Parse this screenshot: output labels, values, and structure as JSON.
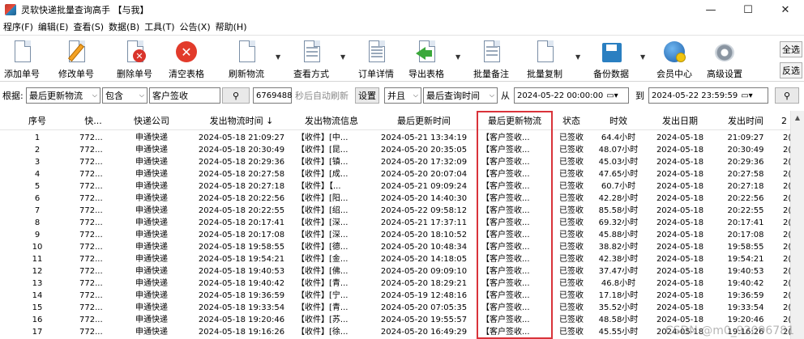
{
  "window": {
    "title": "灵软快递批量查询高手 【与我】",
    "minimize": "—",
    "maximize": "☐",
    "close": "✕"
  },
  "menu": [
    "程序(F)",
    "编辑(E)",
    "查看(S)",
    "数据(B)",
    "工具(T)",
    "公告(X)",
    "帮助(H)"
  ],
  "toolbar": {
    "add": "添加单号",
    "edit": "修改单号",
    "delete": "删除单号",
    "clear": "清空表格",
    "refresh": "刷新物流",
    "view": "查看方式",
    "detail": "订单详情",
    "export": "导出表格",
    "note": "批量备注",
    "copy": "批量复制",
    "backup": "备份数据",
    "member": "会员中心",
    "advanced": "高级设置",
    "select_all": "全选",
    "invert": "反选"
  },
  "filter": {
    "label": "根据:",
    "field": "最后更新物流",
    "op": "包含",
    "value": "客户签收",
    "counter": "6769488",
    "auto_refresh": "秒后自动刷新",
    "settings": "设置",
    "logic": "并且",
    "time_field": "最后查询时间",
    "from": "从",
    "from_value": "2024-05-22 00:00:00",
    "to": "到",
    "to_value": "2024-05-22 23:59:59"
  },
  "table": {
    "headers": [
      "序号",
      "快...",
      "快递公司",
      "发出物流时间 ↓",
      "发出物流信息",
      "最后更新时间",
      "最后更新物流",
      "状态",
      "时效",
      "发出日期",
      "发出时间",
      "2"
    ],
    "rows": [
      [
        "1",
        "772...",
        "申通快递",
        "2024-05-18 21:09:27",
        "【收件】[中...",
        "2024-05-21 13:34:19",
        "【客户签收...",
        "已签收",
        "64.4小时",
        "2024-05-18",
        "21:09:27",
        "2("
      ],
      [
        "2",
        "772...",
        "申通快递",
        "2024-05-18 20:30:49",
        "【收件】[昆...",
        "2024-05-20 20:35:05",
        "【客户签收...",
        "已签收",
        "48.07小时",
        "2024-05-18",
        "20:30:49",
        "2("
      ],
      [
        "3",
        "772...",
        "申通快递",
        "2024-05-18 20:29:36",
        "【收件】[镇...",
        "2024-05-20 17:32:09",
        "【客户签收...",
        "已签收",
        "45.03小时",
        "2024-05-18",
        "20:29:36",
        "2("
      ],
      [
        "4",
        "772...",
        "申通快递",
        "2024-05-18 20:27:58",
        "【收件】[成...",
        "2024-05-20 20:07:04",
        "【客户签收...",
        "已签收",
        "47.65小时",
        "2024-05-18",
        "20:27:58",
        "2("
      ],
      [
        "5",
        "772...",
        "申通快递",
        "2024-05-18 20:27:18",
        "【收件】【...",
        "2024-05-21 09:09:24",
        "【客户签收...",
        "已签收",
        "60.7小时",
        "2024-05-18",
        "20:27:18",
        "2("
      ],
      [
        "6",
        "772...",
        "申通快递",
        "2024-05-18 20:22:56",
        "【收件】[阳...",
        "2024-05-20 14:40:30",
        "【客户签收...",
        "已签收",
        "42.28小时",
        "2024-05-18",
        "20:22:56",
        "2("
      ],
      [
        "7",
        "772...",
        "申通快递",
        "2024-05-18 20:22:55",
        "【收件】[绍...",
        "2024-05-22 09:58:12",
        "【客户签收...",
        "已签收",
        "85.58小时",
        "2024-05-18",
        "20:22:55",
        "2("
      ],
      [
        "8",
        "772...",
        "申通快递",
        "2024-05-18 20:17:41",
        "【收件】[深...",
        "2024-05-21 17:37:11",
        "【客户签收...",
        "已签收",
        "69.32小时",
        "2024-05-18",
        "20:17:41",
        "2("
      ],
      [
        "9",
        "772...",
        "申通快递",
        "2024-05-18 20:17:08",
        "【收件】[深...",
        "2024-05-20 18:10:52",
        "【客户签收...",
        "已签收",
        "45.88小时",
        "2024-05-18",
        "20:17:08",
        "2("
      ],
      [
        "10",
        "772...",
        "申通快递",
        "2024-05-18 19:58:55",
        "【收件】[德...",
        "2024-05-20 10:48:34",
        "【客户签收...",
        "已签收",
        "38.82小时",
        "2024-05-18",
        "19:58:55",
        "2("
      ],
      [
        "11",
        "772...",
        "申通快递",
        "2024-05-18 19:54:21",
        "【收件】[金...",
        "2024-05-20 14:18:05",
        "【客户签收...",
        "已签收",
        "42.38小时",
        "2024-05-18",
        "19:54:21",
        "2("
      ],
      [
        "12",
        "772...",
        "申通快递",
        "2024-05-18 19:40:53",
        "【收件】[佛...",
        "2024-05-20 09:09:10",
        "【客户签收...",
        "已签收",
        "37.47小时",
        "2024-05-18",
        "19:40:53",
        "2("
      ],
      [
        "13",
        "772...",
        "申通快递",
        "2024-05-18 19:40:42",
        "【收件】[青...",
        "2024-05-20 18:29:21",
        "【客户签收...",
        "已签收",
        "46.8小时",
        "2024-05-18",
        "19:40:42",
        "2("
      ],
      [
        "14",
        "772...",
        "申通快递",
        "2024-05-18 19:36:59",
        "【收件】[宁...",
        "2024-05-19 12:48:16",
        "【客户签收...",
        "已签收",
        "17.18小时",
        "2024-05-18",
        "19:36:59",
        "2("
      ],
      [
        "15",
        "772...",
        "申通快递",
        "2024-05-18 19:33:54",
        "【收件】[青...",
        "2024-05-20 07:05:35",
        "【客户签收...",
        "已签收",
        "35.52小时",
        "2024-05-18",
        "19:33:54",
        "2("
      ],
      [
        "16",
        "772...",
        "申通快递",
        "2024-05-18 19:20:46",
        "【收件】[苏...",
        "2024-05-20 19:55:57",
        "【客户签收...",
        "已签收",
        "48.58小时",
        "2024-05-18",
        "19:20:46",
        "2("
      ],
      [
        "17",
        "772...",
        "申通快递",
        "2024-05-18 19:16:26",
        "【收件】[徐...",
        "2024-05-20 16:49:29",
        "【客户签收...",
        "已签收",
        "45.55小时",
        "2024-05-18",
        "19:16:26",
        "2("
      ]
    ]
  },
  "watermark": "CSDN @m0_92096781",
  "colors": {
    "highlight": "#d9333a"
  }
}
